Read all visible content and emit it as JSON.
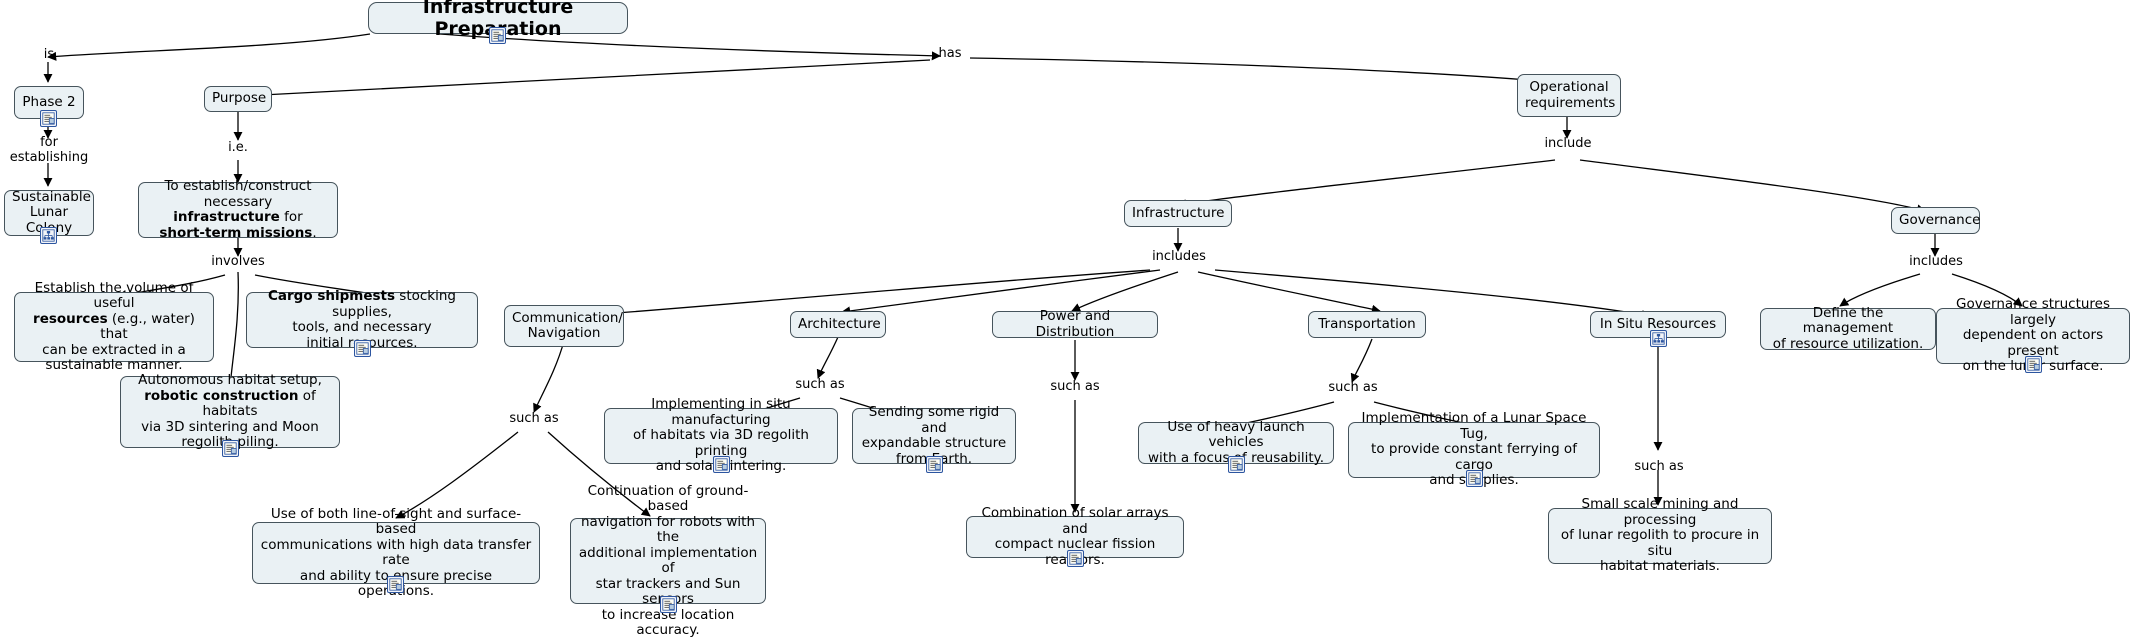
{
  "diagram": {
    "title": "Infrastructure Preparation",
    "type": "concept-map",
    "colors": {
      "node_fill": "#eaf1f4",
      "node_border": "#46545c",
      "icon_border": "#2c55a0",
      "line": "#000000",
      "background": "#ffffff"
    }
  },
  "nodes": {
    "root": "Infrastructure Preparation",
    "phase2": "Phase 2",
    "sustainable_colony": "Sustainable\nLunar Colony",
    "purpose": "Purpose",
    "purpose_detail_pre": "To establish/construct necessary",
    "purpose_detail_b1": "infrastructure",
    "purpose_detail_mid": " for",
    "purpose_detail_b2": "short-term missions",
    "purpose_detail_end": ".",
    "resources_volume_l1": "Establish the volume of useful",
    "resources_volume_b": "resources",
    "resources_volume_l2": " (e.g., water) that",
    "resources_volume_l3": "can be extracted in a",
    "resources_volume_l4": "sustainable manner.",
    "cargo_b": "Cargo shipmests",
    "cargo_l1": " stocking supplies,",
    "cargo_l2": "tools, and necessary",
    "cargo_l3": "initial resources.",
    "habitat_l1": "Autonomous habitat setup,",
    "habitat_b": "robotic construction",
    "habitat_l2": " of habitats",
    "habitat_l3": "via 3D sintering and Moon",
    "habitat_l4": "regolith piling.",
    "operational_requirements": "Operational\nrequirements",
    "infrastructure": "Infrastructure",
    "governance": "Governance",
    "communication_navigation": "Communication/\nNavigation",
    "architecture": "Architecture",
    "power_distribution": "Power and Distribution",
    "transportation": "Transportation",
    "in_situ_resources": "In Situ Resources",
    "comm_line_of_sight": "Use of both line-of-sight and surface-based\ncommunications with high data transfer rate\nand ability to ensure precise operations.",
    "comm_ground_based": "Continuation of ground-based\nnavigation for robots with the\nadditional implementation of\nstar trackers and Sun sensors\nto increase location accuracy.",
    "arch_in_situ": "Implementing in situ manufacturing\nof habitats via 3D regolith printing\nand solar sintering.",
    "arch_rigid": "Sending some rigid and\nexpandable structure\nfrom Earth.",
    "power_solar": "Combination of solar arrays and\ncompact nuclear fission reactors.",
    "transport_heavy": "Use of heavy launch vehicles\nwith a focus of reusability.",
    "transport_tug": "Implementation of a Lunar Space Tug,\nto provide constant ferrying of cargo\nand supplies.",
    "isru_mining": "Small scale mining and processing\nof lunar regolith to procure in situ\nhabitat materials.",
    "gov_define": "Define the management\nof resource utilization.",
    "gov_structures": "Governance structures largely\ndependent on actors present\non the lunar surface."
  },
  "links": {
    "is": "is",
    "has": "has",
    "for_establishing": "for\nestablishing",
    "ie": "i.e.",
    "involves": "involves",
    "include": "include",
    "includes_infrastructure": "includes",
    "includes_governance": "includes",
    "such_as_comm": "such as",
    "such_as_arch": "such as",
    "such_as_power": "such as",
    "such_as_transport": "such as",
    "such_as_isru": "such as"
  },
  "icons": {
    "note": "note-resource-icon",
    "map": "concept-map-resource-icon"
  }
}
